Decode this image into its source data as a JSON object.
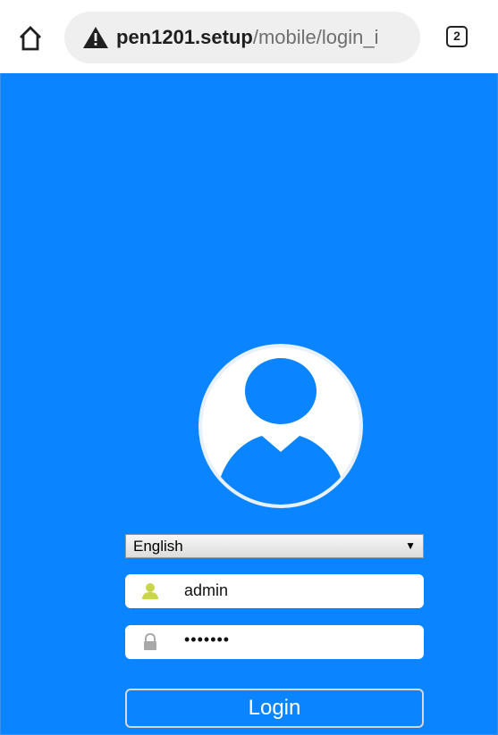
{
  "browser": {
    "url_host": "pen1201.setup",
    "url_path": "/mobile/login_i",
    "tab_count": "2",
    "icons": {
      "home": "home-icon",
      "warning": "warning-icon",
      "tabs": "tabs-icon"
    }
  },
  "login": {
    "language": "English",
    "language_arrow": "▼",
    "username": "admin",
    "password_mask": "•••••••",
    "login_label": "Login",
    "icons": {
      "avatar": "user-avatar-icon",
      "user": "user-icon",
      "lock": "lock-icon"
    }
  },
  "colors": {
    "page_background": "#0a84ff",
    "user_icon": "#c9d64a",
    "lock_icon": "#a9a9a9"
  }
}
